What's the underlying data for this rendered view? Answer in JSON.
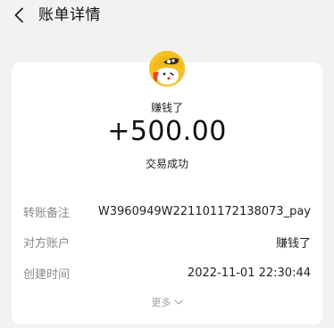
{
  "header": {
    "title": "账单详情",
    "back_icon": "chevron-left-icon"
  },
  "bill": {
    "avatar_icon": "cartoon-avatar-icon",
    "payee": "赚钱了",
    "amount": "+500.00",
    "status": "交易成功"
  },
  "details": [
    {
      "label": "转账备注",
      "value": "W3960949W221101172138073_pay"
    },
    {
      "label": "对方账户",
      "value": "赚钱了"
    },
    {
      "label": "创建时间",
      "value": "2022-11-01 22:30:44"
    }
  ],
  "more": {
    "label": "更多",
    "icon": "chevron-down-icon"
  }
}
